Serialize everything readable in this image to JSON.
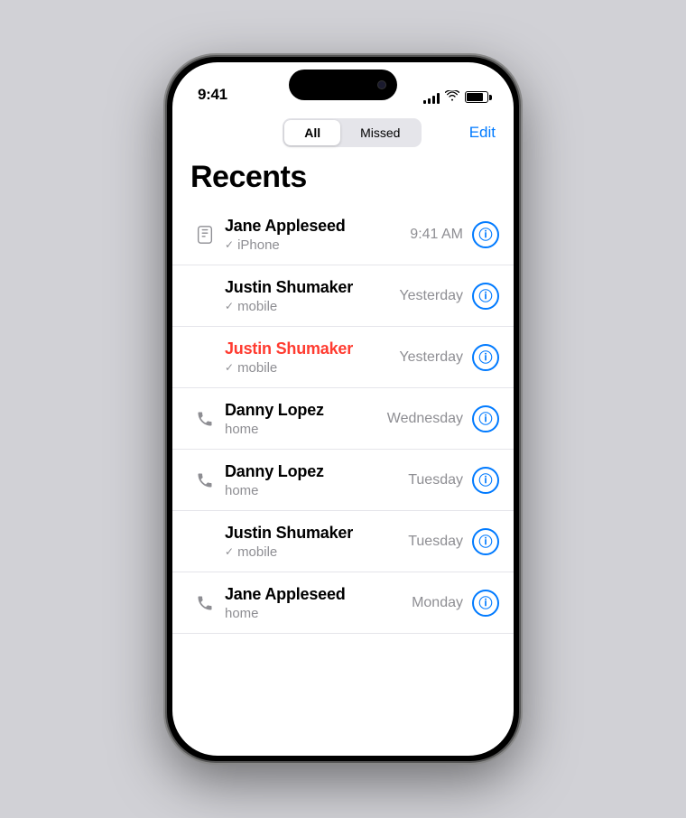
{
  "phone": {
    "status_bar": {
      "time": "9:41",
      "signal_bars": [
        4,
        6,
        9,
        12,
        14
      ],
      "wifi": "wifi",
      "battery_percent": 80
    },
    "segment_control": {
      "options": [
        "All",
        "Missed"
      ],
      "active": "Missed",
      "edit_label": "Edit"
    },
    "page_title": "Recents",
    "calls": [
      {
        "id": 1,
        "name": "Jane Appleseed",
        "missed": false,
        "call_type": "iPhone",
        "time": "9:41 AM",
        "icon_type": "phone_filled"
      },
      {
        "id": 2,
        "name": "Justin Shumaker",
        "missed": false,
        "call_type": "mobile",
        "time": "Yesterday",
        "icon_type": "check"
      },
      {
        "id": 3,
        "name": "Justin Shumaker",
        "missed": true,
        "call_type": "mobile",
        "time": "Yesterday",
        "icon_type": "check"
      },
      {
        "id": 4,
        "name": "Danny Lopez",
        "missed": false,
        "call_type": "home",
        "time": "Wednesday",
        "icon_type": "phone_missed"
      },
      {
        "id": 5,
        "name": "Danny Lopez",
        "missed": false,
        "call_type": "home",
        "time": "Tuesday",
        "icon_type": "phone_missed"
      },
      {
        "id": 6,
        "name": "Justin Shumaker",
        "missed": false,
        "call_type": "mobile",
        "time": "Tuesday",
        "icon_type": "check"
      },
      {
        "id": 7,
        "name": "Jane Appleseed",
        "missed": false,
        "call_type": "home",
        "time": "Monday",
        "icon_type": "phone_missed"
      }
    ]
  }
}
